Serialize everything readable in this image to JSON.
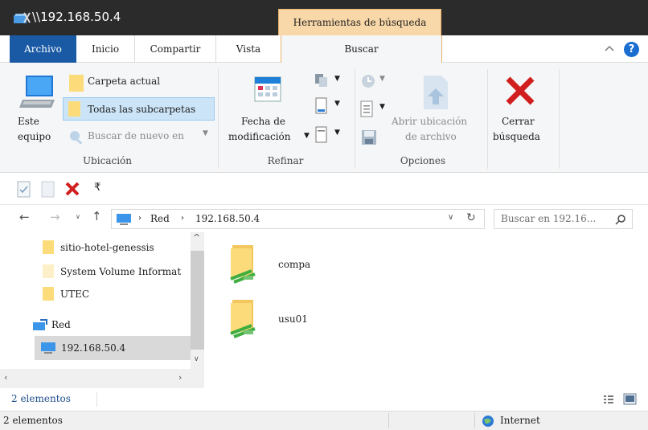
{
  "window": {
    "title": "\\\\192.168.50.4",
    "context_tab_title": "Herramientas de búsqueda"
  },
  "tabs": [
    {
      "label": "Archivo"
    },
    {
      "label": "Inicio"
    },
    {
      "label": "Compartir"
    },
    {
      "label": "Vista"
    },
    {
      "label": "Buscar"
    }
  ],
  "ribbon": {
    "ubicacion": {
      "este_equipo": [
        "Este",
        "equipo"
      ],
      "carpeta_actual": "Carpeta actual",
      "todas_subcarpetas": "Todas las subcarpetas",
      "buscar_de_nuevo": "Buscar de nuevo en",
      "group": "Ubicación"
    },
    "refinar": {
      "fecha": [
        "Fecha de",
        "modificación"
      ],
      "group": "Refinar"
    },
    "opciones": {
      "abrir": [
        "Abrir ubicación",
        "de archivo"
      ],
      "group": "Opciones"
    },
    "cerrar": [
      "Cerrar",
      "búsqueda"
    ]
  },
  "address": {
    "segments": [
      "Red",
      "192.168.50.4"
    ],
    "search_placeholder": "Buscar en 192.16..."
  },
  "nav_pane": [
    {
      "label": "sitio-hotel-genessis",
      "icon": "folder-icon"
    },
    {
      "label": "System Volume Informat",
      "icon": "folder-icon"
    },
    {
      "label": "UTEC",
      "icon": "folder-icon"
    },
    {
      "label": "Red",
      "icon": "network-icon"
    },
    {
      "label": "192.168.50.4",
      "icon": "computer-icon"
    }
  ],
  "items": [
    {
      "name": "compa",
      "icon": "network-share-icon"
    },
    {
      "name": "usu01",
      "icon": "network-share-icon"
    }
  ],
  "status": {
    "count": "2 elementos",
    "bottom_count": "2 elementos",
    "zone": "Internet"
  },
  "colors": {
    "accent": "#1a5aa5",
    "context_tab": "#f8d7a8",
    "close_red": "#d11f1f"
  }
}
